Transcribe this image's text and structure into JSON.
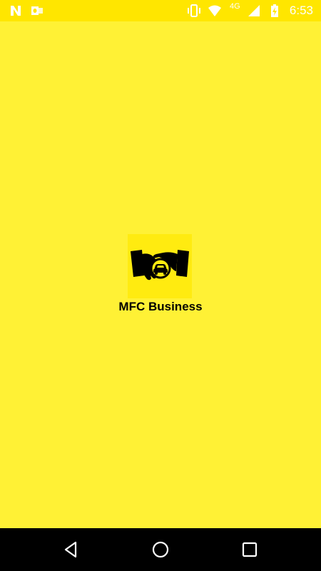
{
  "status_bar": {
    "time": "6:53",
    "network": "4G",
    "icons": [
      "n-notification-icon",
      "outlook-icon",
      "vibrate-icon",
      "wifi-icon",
      "signal-icon",
      "battery-charging-icon"
    ]
  },
  "splash": {
    "app_name": "MFC Business",
    "logo": "handshake-car-logo-icon",
    "background_color": "#FFF135"
  },
  "nav_bar": {
    "buttons": [
      "back-icon",
      "home-icon",
      "recents-icon"
    ]
  }
}
